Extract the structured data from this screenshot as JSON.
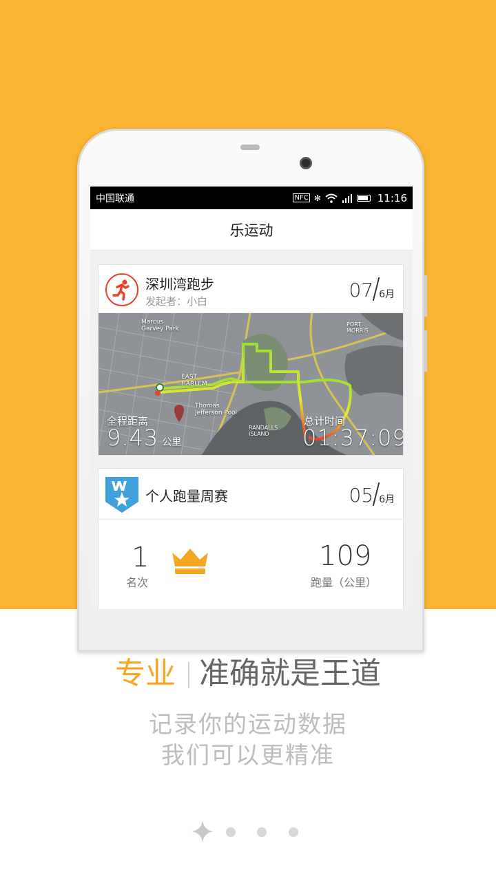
{
  "status_bar": {
    "carrier": "中国联通",
    "nfc": "NFC",
    "time": "11:16"
  },
  "app_bar": {
    "title": "乐运动"
  },
  "event_card": {
    "title": "深圳湾跑步",
    "organizer": "发起者：小白",
    "date_day": "07",
    "date_month": "6月",
    "distance_label": "全程距离",
    "distance_value": "9.43",
    "distance_unit": "公里",
    "time_label": "总计时间",
    "time_value": "01:37:09",
    "map_labels": {
      "marcus": "Marcus Garvey Park",
      "east_harlem": "EAST HARLEM",
      "randalls": "RANDALLS ISLAND",
      "thomas": "Thomas Jefferson Pool",
      "port_morris": "PORT MORRIS"
    }
  },
  "weekly_card": {
    "title": "个人跑量周赛",
    "date_day": "05",
    "date_month": "6月",
    "rank_value": "1",
    "rank_label": "名次",
    "distance_value": "109",
    "distance_label": "跑量（公里）"
  },
  "promo": {
    "headline_highlight": "专业",
    "headline_rest": "准确就是王道",
    "line1": "记录你的运动数据",
    "line2": "我们可以更精准"
  },
  "pager": {
    "total_pages": 4,
    "active_page": 1
  },
  "colors": {
    "background_top": "#F8B432",
    "accent": "#F5A623",
    "route_green": "#7CD42A",
    "route_red": "#E8432E"
  }
}
